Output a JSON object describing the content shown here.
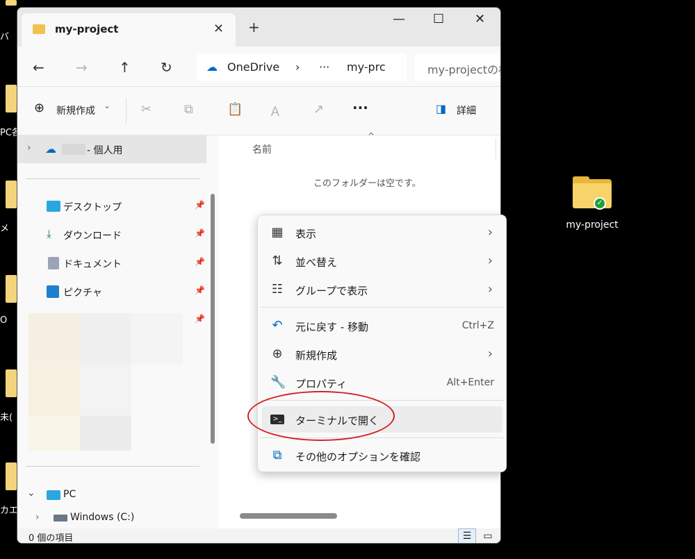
{
  "desktop": {
    "left_labels": [
      "バ",
      "PC各",
      "メ",
      "O",
      "未(",
      "カエ|"
    ],
    "folder_label": "my-project"
  },
  "window": {
    "tab_title": "my-project",
    "tab_close": "✕",
    "new_tab": "+",
    "minimize": "—",
    "maximize": "☐",
    "close": "✕"
  },
  "navbar": {
    "back": "←",
    "forward": "→",
    "up": "↑",
    "refresh": "↻",
    "address_root": "OneDrive",
    "address_sep": "›",
    "address_more": "···",
    "address_current": "my-prc",
    "search_placeholder": "my-projectの検"
  },
  "toolbar": {
    "new_label": "新規作成",
    "new_chevron": "⌄",
    "more": "···",
    "details_label": "詳細"
  },
  "sidebar": {
    "onedrive_label": "- 個人用",
    "quick": [
      {
        "label": "デスクトップ",
        "pin": "📌"
      },
      {
        "label": "ダウンロード",
        "pin": "📌"
      },
      {
        "label": "ドキュメント",
        "pin": "📌"
      },
      {
        "label": "ピクチャ",
        "pin": "📌"
      }
    ],
    "pc_label": "PC",
    "drive_label": "Windows (C:)"
  },
  "content": {
    "col_name": "名前",
    "empty_text": "このフォルダーは空です。"
  },
  "status": {
    "text": "0 個の項目"
  },
  "context_menu": {
    "items": [
      {
        "label": "表示",
        "icon": "grid-icon",
        "right": "›"
      },
      {
        "label": "並べ替え",
        "icon": "sort-icon",
        "right": "›"
      },
      {
        "label": "グループで表示",
        "icon": "group-icon",
        "right": "›"
      },
      {
        "label": "元に戻す - 移動",
        "icon": "undo-icon",
        "shortcut": "Ctrl+Z"
      },
      {
        "label": "新規作成",
        "icon": "new-icon",
        "right": "›"
      },
      {
        "label": "プロパティ",
        "icon": "wrench-icon",
        "shortcut": "Alt+Enter"
      },
      {
        "label": "ターミナルで開く",
        "icon": "terminal-icon"
      },
      {
        "label": "その他のオプションを確認",
        "icon": "share-icon"
      }
    ]
  },
  "colors": {
    "highlight_ellipse": "#d42027",
    "accent_blue": "#0067c0"
  }
}
